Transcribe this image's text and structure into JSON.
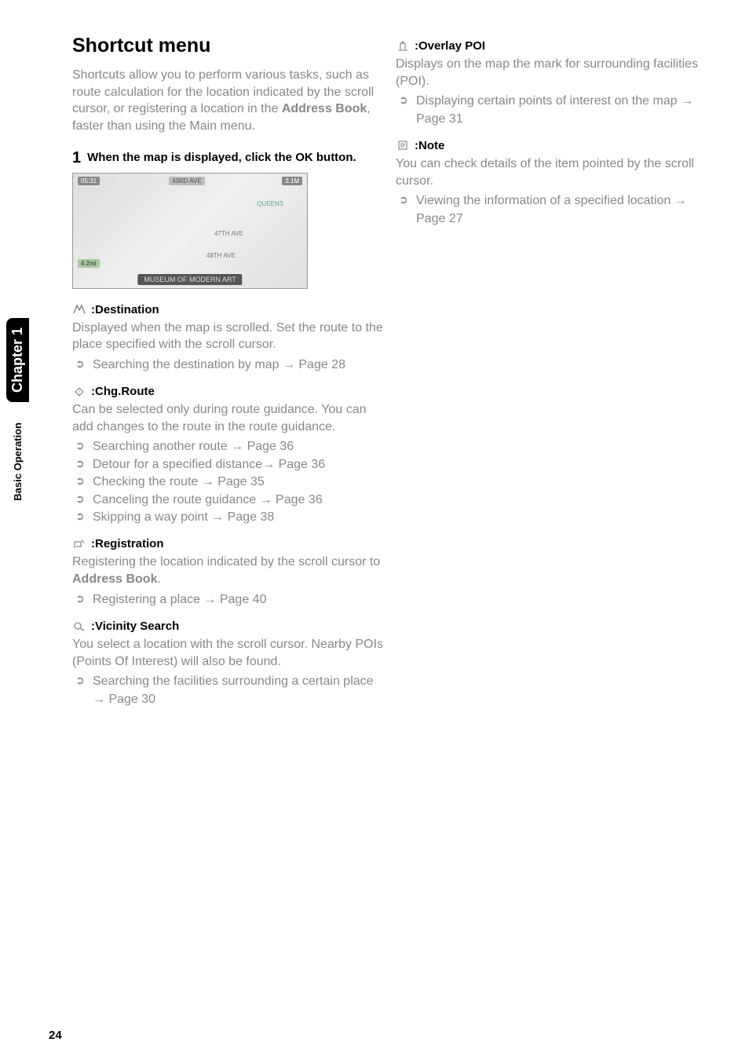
{
  "sidebar": {
    "chapter": "Chapter 1",
    "section": "Basic Operation"
  },
  "page_number": "24",
  "left": {
    "title": "Shortcut menu",
    "intro_pre": "Shortcuts allow you to perform various tasks, such as route calculation for the location indicated by the scroll cursor, or registering a location in the ",
    "intro_bold": "Address Book",
    "intro_post": ", faster than using the Main menu.",
    "step_num": "1",
    "step_text": "When the map is displayed, click the OK button.",
    "map": {
      "time": "05:31",
      "top_street": "43RD AVE",
      "scale": "3.1M",
      "area": "QUEENS",
      "mid_street": "47TH AVE",
      "low_street": "48TH AVE",
      "dist": "4.2mi",
      "banner": "MUSEUM OF MODERN ART"
    },
    "features": [
      {
        "label": ":Destination",
        "icon": "destination",
        "desc": "Displayed when the map is scrolled. Set the route to the place specified with the scroll cursor.",
        "refs": [
          {
            "text": "Searching the destination by map → Page 28"
          }
        ]
      },
      {
        "label": ":Chg.Route",
        "icon": "chgroute",
        "desc": "Can be selected only during route guidance. You can add changes to the route in the route guidance.",
        "refs": [
          {
            "text": "Searching another route → Page 36"
          },
          {
            "text": "Detour for a specified distance→ Page 36"
          },
          {
            "text": "Checking the route → Page 35"
          },
          {
            "text": "Canceling the route guidance → Page 36"
          },
          {
            "text": "Skipping a way point → Page 38"
          }
        ]
      },
      {
        "label": ":Registration",
        "icon": "registration",
        "desc_pre": "Registering the location indicated by the scroll cursor to ",
        "desc_bold": "Address Book",
        "desc_post": ".",
        "refs": [
          {
            "text": "Registering a place → Page 40"
          }
        ]
      },
      {
        "label": ":Vicinity Search",
        "icon": "vicinity",
        "desc": "You select a location with the scroll cursor. Nearby POIs (Points Of Interest) will also be found.",
        "refs": [
          {
            "text": "Searching the facilities surrounding a certain place → Page 30"
          }
        ]
      }
    ]
  },
  "right": {
    "features": [
      {
        "label": ":Overlay POI",
        "icon": "overlaypoi",
        "desc": "Displays on the map the mark for surrounding facilities (POI).",
        "refs": [
          {
            "text": "Displaying certain points of interest on the map → Page 31"
          }
        ]
      },
      {
        "label": ":Note",
        "icon": "note",
        "desc": "You can check details of the item pointed by the scroll cursor.",
        "refs": [
          {
            "text": "Viewing the information of a specified location → Page 27"
          }
        ]
      }
    ]
  }
}
